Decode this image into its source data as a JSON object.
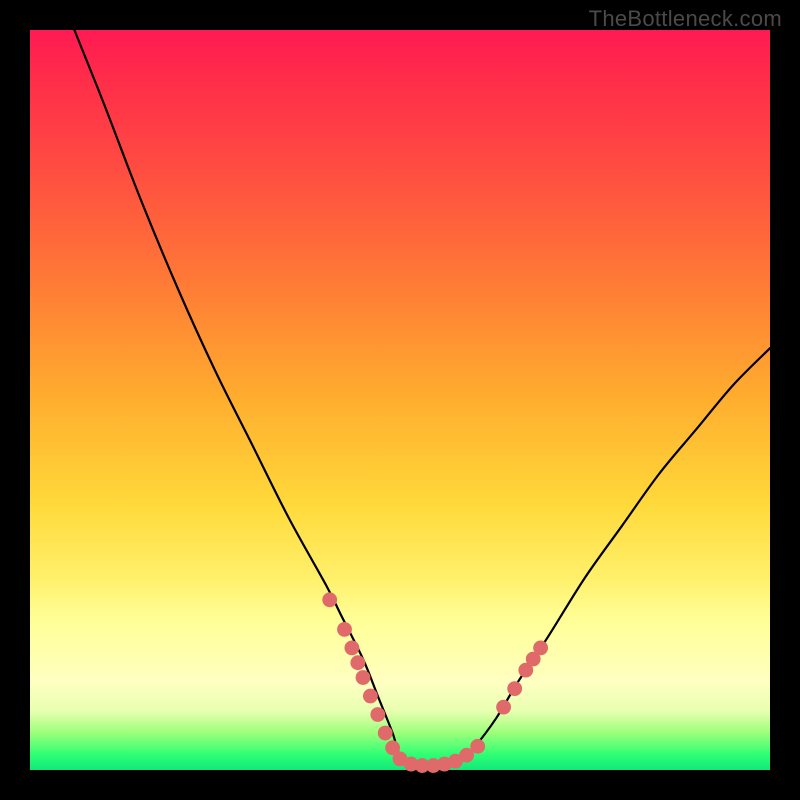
{
  "watermark": "TheBottleneck.com",
  "colors": {
    "watermark": "#4a4a4a",
    "curve": "#000000",
    "dots": "#e06969",
    "gradient_top": "#ff1a53",
    "gradient_bottom": "#12e87a"
  },
  "chart_data": {
    "type": "line",
    "title": "",
    "xlabel": "",
    "ylabel": "",
    "xlim": [
      0,
      100
    ],
    "ylim": [
      0,
      100
    ],
    "note": "No axes or tick labels are shown; values are estimated normalized positions (0–100 in each axis) of the single black V-shaped curve and the salmon dot markers on it.",
    "series": [
      {
        "name": "curve",
        "x": [
          6,
          10,
          15,
          20,
          25,
          30,
          35,
          40,
          42,
          45,
          47,
          49,
          50,
          52,
          55,
          58,
          60,
          63,
          66,
          70,
          75,
          80,
          85,
          90,
          95,
          100
        ],
        "y": [
          100,
          90,
          77,
          65,
          54,
          44,
          34,
          25,
          21,
          15,
          10,
          5,
          2,
          1,
          0.5,
          1,
          3,
          7,
          12,
          18,
          26,
          33,
          40,
          46,
          52,
          57
        ]
      }
    ],
    "dots": [
      {
        "x": 40.5,
        "y": 23
      },
      {
        "x": 42.5,
        "y": 19
      },
      {
        "x": 43.5,
        "y": 16.5
      },
      {
        "x": 44.3,
        "y": 14.5
      },
      {
        "x": 45.0,
        "y": 12.5
      },
      {
        "x": 46.0,
        "y": 10
      },
      {
        "x": 47.0,
        "y": 7.5
      },
      {
        "x": 48.0,
        "y": 5
      },
      {
        "x": 49.0,
        "y": 3
      },
      {
        "x": 50.0,
        "y": 1.5
      },
      {
        "x": 51.5,
        "y": 0.8
      },
      {
        "x": 53.0,
        "y": 0.6
      },
      {
        "x": 54.5,
        "y": 0.6
      },
      {
        "x": 56.0,
        "y": 0.8
      },
      {
        "x": 57.5,
        "y": 1.2
      },
      {
        "x": 59.0,
        "y": 2
      },
      {
        "x": 60.5,
        "y": 3.2
      },
      {
        "x": 64.0,
        "y": 8.5
      },
      {
        "x": 65.5,
        "y": 11
      },
      {
        "x": 67.0,
        "y": 13.5
      },
      {
        "x": 68.0,
        "y": 15
      },
      {
        "x": 69.0,
        "y": 16.5
      }
    ]
  }
}
